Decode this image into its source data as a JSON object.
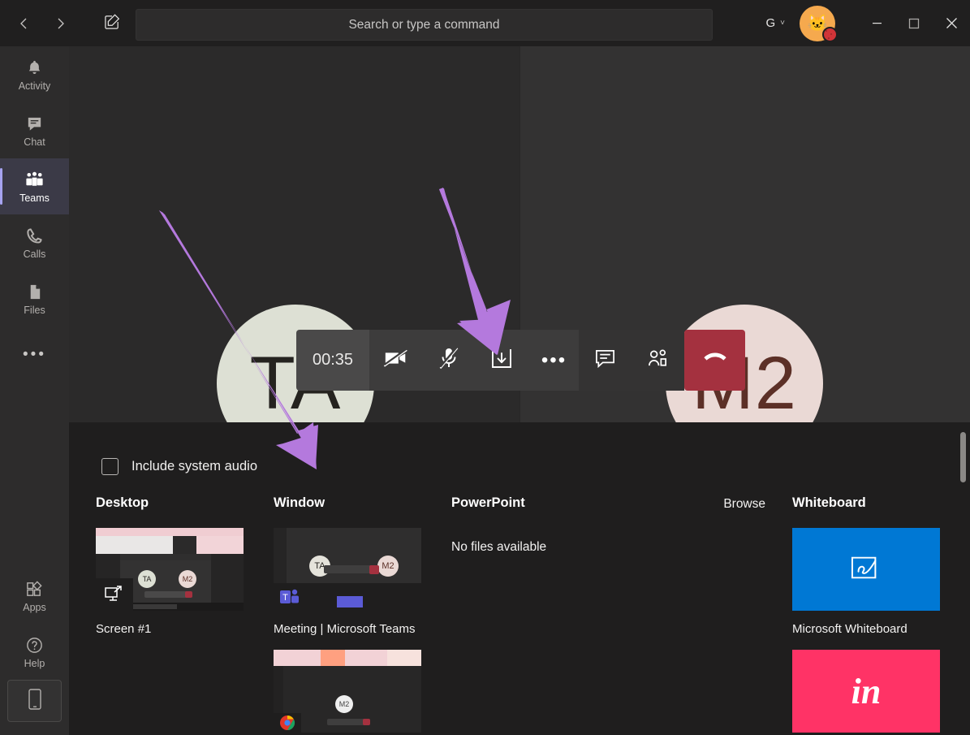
{
  "titlebar": {
    "back_icon": "chevron-left-icon",
    "forward_icon": "chevron-right-icon",
    "compose_icon": "compose-new-chat-icon",
    "account_initial": "G",
    "chevron": "˅",
    "avatar_emoji": "🐱",
    "minimize_label": "Minimize",
    "maximize_label": "Maximize",
    "close_label": "Close"
  },
  "search": {
    "placeholder": "Search or type a command",
    "value": "Search or type a command"
  },
  "rail": {
    "items": [
      {
        "label": "Activity",
        "icon": "bell-icon",
        "active": false
      },
      {
        "label": "Chat",
        "icon": "chat-bubble-icon",
        "active": false
      },
      {
        "label": "Teams",
        "icon": "teams-people-icon",
        "active": true
      },
      {
        "label": "Calls",
        "icon": "phone-icon",
        "active": false
      },
      {
        "label": "Files",
        "icon": "file-icon",
        "active": false
      }
    ],
    "more_label": "•••",
    "bottom_items": [
      {
        "label": "Apps",
        "icon": "apps-grid-icon"
      },
      {
        "label": "Help",
        "icon": "help-question-icon"
      }
    ],
    "mobile_icon": "mobile-phone-icon"
  },
  "meeting": {
    "timer": "00:35",
    "participants": [
      {
        "initials": "TA",
        "bg": "#dde0d4",
        "fg": "#25231f"
      },
      {
        "initials": "M2",
        "bg": "#ead9d5",
        "fg": "#5c3027"
      }
    ],
    "controls": [
      {
        "name": "camera-off-icon",
        "label": "Turn camera on"
      },
      {
        "name": "microphone-muted-icon",
        "label": "Unmute"
      },
      {
        "name": "share-screen-icon",
        "label": "Share"
      },
      {
        "name": "more-options-icon",
        "label": "More actions"
      },
      {
        "name": "chat-icon",
        "label": "Show conversation"
      },
      {
        "name": "participants-icon",
        "label": "Show participants"
      }
    ],
    "hangup": {
      "name": "hangup-icon",
      "label": "Hang up",
      "color": "#a4313f"
    }
  },
  "share_tray": {
    "include_system_audio": {
      "label": "Include system audio",
      "checked": false
    },
    "columns": {
      "desktop": {
        "title": "Desktop",
        "items": [
          {
            "label": "Screen #1"
          }
        ]
      },
      "window": {
        "title": "Window",
        "items": [
          {
            "label": "Meeting | Microsoft Teams"
          },
          {
            "label": ""
          }
        ]
      },
      "powerpoint": {
        "title": "PowerPoint",
        "browse_label": "Browse",
        "empty_message": "No files available"
      },
      "whiteboard": {
        "title": "Whiteboard",
        "items": [
          {
            "label": "Microsoft Whiteboard",
            "color": "#0078d4",
            "icon": "whiteboard-pen-icon"
          },
          {
            "label": "",
            "color": "#ff3366",
            "icon": "invision-in-logo",
            "glyph": "in"
          }
        ]
      }
    }
  },
  "annotations": {
    "arrow_color": "#b479dd",
    "arrows": [
      {
        "name": "arrow-to-share-tray"
      },
      {
        "name": "arrow-to-share-button"
      }
    ]
  }
}
